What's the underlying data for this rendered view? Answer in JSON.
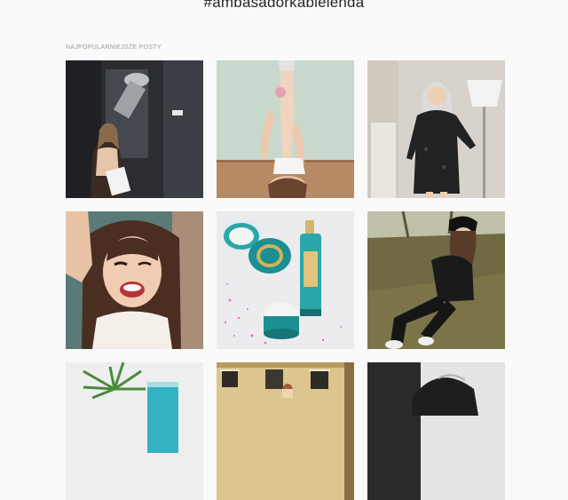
{
  "header": {
    "hashtag": "#ambasadorkabielenda"
  },
  "section": {
    "label": "NAJPOPULARNIEJSZE POSTY"
  },
  "posts": [
    {
      "name": "post-1",
      "subject": "woman-studio-mirror"
    },
    {
      "name": "post-2",
      "subject": "woman-legs-up-floor"
    },
    {
      "name": "post-3",
      "subject": "woman-black-dress-lamp"
    },
    {
      "name": "post-4",
      "subject": "woman-winking-selfie"
    },
    {
      "name": "post-5",
      "subject": "cosmetics-jars-bottle"
    },
    {
      "name": "post-6",
      "subject": "woman-beanie-sitting-grass"
    },
    {
      "name": "post-7",
      "subject": "plant-and-product"
    },
    {
      "name": "post-8",
      "subject": "building-facade"
    },
    {
      "name": "post-9",
      "subject": "woman-bw-portrait"
    }
  ]
}
